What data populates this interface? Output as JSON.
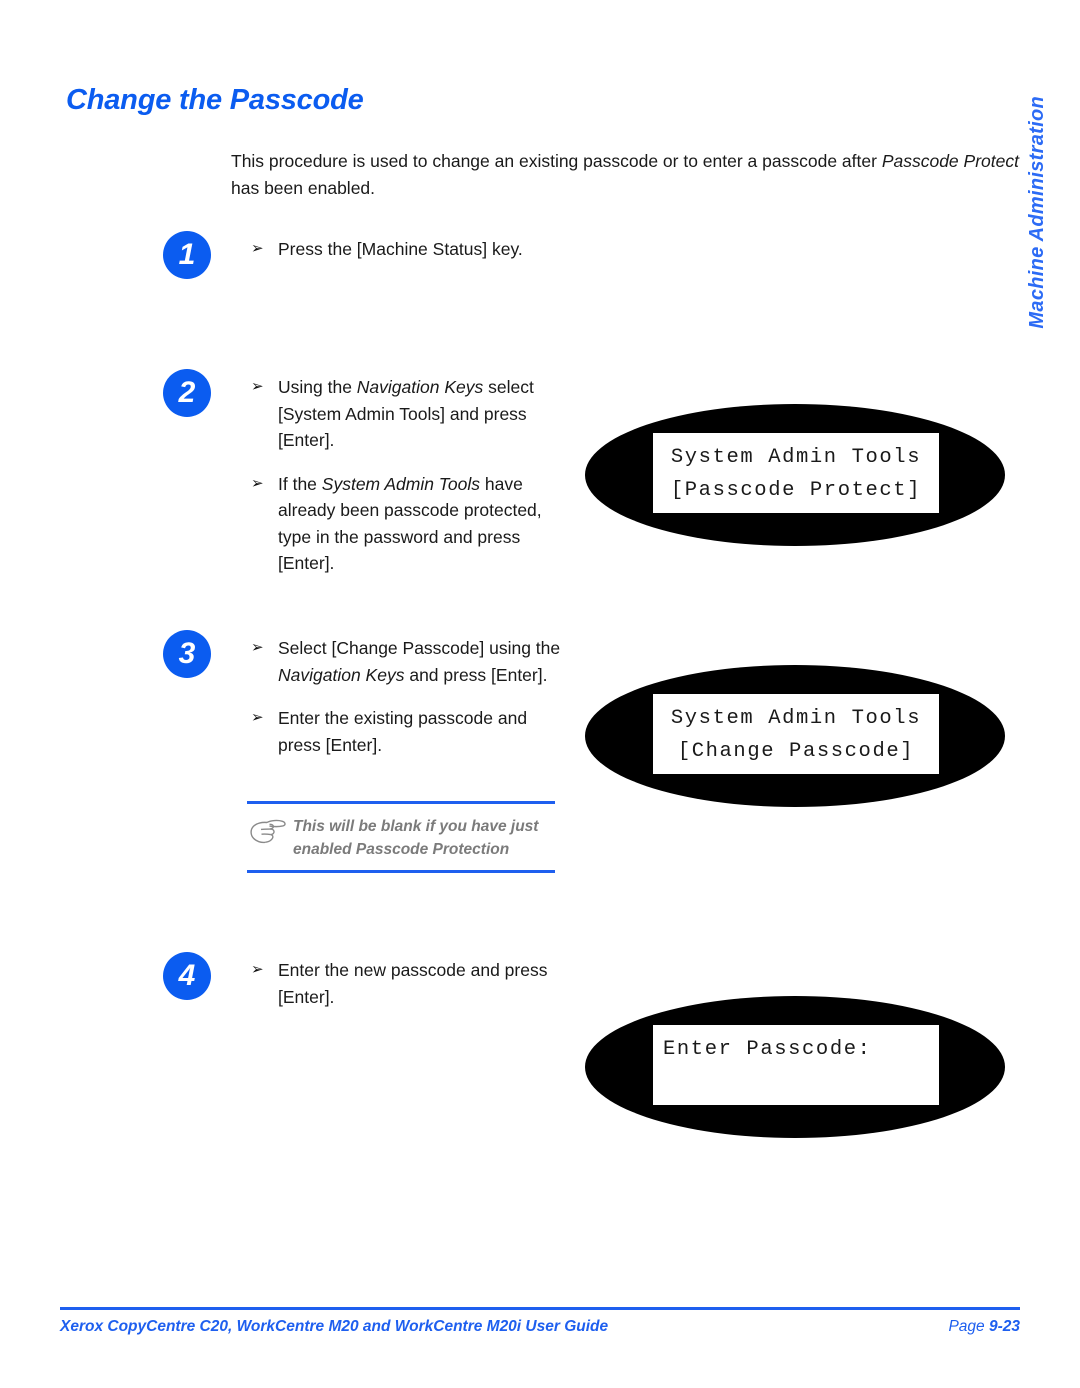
{
  "page": {
    "heading": "Change the Passcode",
    "side_tab": "Machine Administration",
    "accent_color": "#0B5CF0",
    "footer_rule_color": "#1E5FEF"
  },
  "intro": {
    "part1": "This procedure is used to change an existing passcode or to enter a passcode after ",
    "italic1": "Passcode Protect",
    "part2": " has been enabled."
  },
  "steps": [
    {
      "number": "1",
      "bullets": [
        {
          "arrow": "➢",
          "part1": "Press the [Machine Status] key.",
          "italic1": "",
          "part2": ""
        }
      ]
    },
    {
      "number": "2",
      "bullets": [
        {
          "arrow": "➢",
          "part1": "Using the ",
          "italic1": "Navigation Keys",
          "part2": " select [System Admin Tools] and press [Enter]."
        },
        {
          "arrow": "➢",
          "part1": "If the ",
          "italic1": "System Admin Tools",
          "part2": " have already been passcode protected, type in the password and press [Enter]."
        }
      ]
    },
    {
      "number": "3",
      "bullets": [
        {
          "arrow": "➢",
          "part1": "Select [Change Passcode] using the ",
          "italic1": "Navigation Keys",
          "part2": " and press [Enter]."
        },
        {
          "arrow": "➢",
          "part1": "Enter the existing passcode and press [Enter].",
          "italic1": "",
          "part2": ""
        }
      ]
    },
    {
      "number": "4",
      "bullets": [
        {
          "arrow": "➢",
          "part1": "Enter the new passcode and press [Enter].",
          "italic1": "",
          "part2": ""
        }
      ]
    }
  ],
  "note": {
    "icon": "pointing-hand-icon",
    "line1": "This will be blank if you have just",
    "line2": "enabled Passcode Protection"
  },
  "lcd_displays": [
    {
      "align": "center",
      "line1": "System Admin Tools",
      "line2": "[Passcode Protect]"
    },
    {
      "align": "center",
      "line1": "System Admin Tools",
      "line2": "[Change Passcode]"
    },
    {
      "align": "left",
      "line1": "Enter Passcode:",
      "line2": ""
    }
  ],
  "footer": {
    "guide_title": "Xerox CopyCentre C20, WorkCentre M20 and WorkCentre M20i User Guide",
    "page_label": "Page ",
    "page_number": "9-23"
  }
}
